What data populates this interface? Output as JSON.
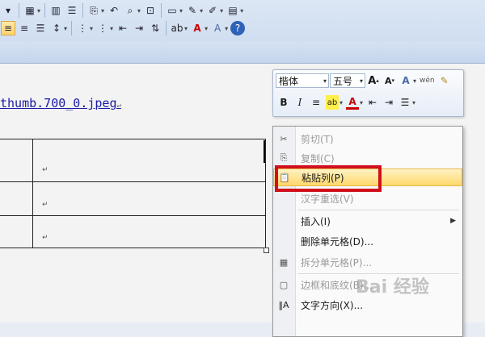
{
  "document": {
    "link_text": "thumb.700_0.jpeg",
    "paragraph_mark": "↵"
  },
  "mini_toolbar": {
    "font_name": "楷体",
    "font_size": "五号",
    "grow_font": "A",
    "shrink_font": "A",
    "bold": "B",
    "italic": "I"
  },
  "context_menu": {
    "items": [
      {
        "label": "剪切(T)",
        "enabled": false,
        "icon": "scissors-icon"
      },
      {
        "label": "复制(C)",
        "enabled": false,
        "icon": "copy-icon"
      },
      {
        "label": "粘贴列(P)",
        "enabled": true,
        "icon": "paste-icon",
        "highlighted": true
      },
      {
        "label": "汉字重选(V)",
        "enabled": false,
        "icon": ""
      },
      {
        "label": "插入(I)",
        "enabled": true,
        "icon": "",
        "submenu": true
      },
      {
        "label": "删除单元格(D)...",
        "enabled": true,
        "icon": ""
      },
      {
        "label": "拆分单元格(P)...",
        "enabled": false,
        "icon": "split-cells-icon"
      },
      {
        "label": "边框和底纹(B)...",
        "enabled": false,
        "icon": "borders-icon"
      },
      {
        "label": "文字方向(X)...",
        "enabled": true,
        "icon": "text-direction-icon"
      }
    ]
  },
  "watermark": "Bai 经验",
  "colors": {
    "highlight_box": "#d0101a",
    "link": "#1a1aa6",
    "ribbon_bg": "#dce7f5"
  }
}
